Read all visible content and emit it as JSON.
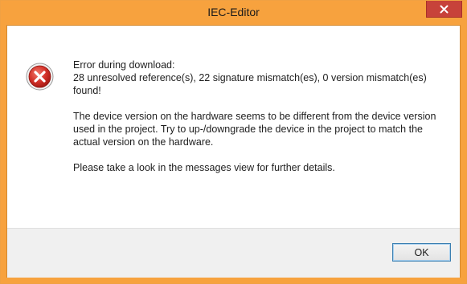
{
  "window": {
    "title": "IEC-Editor",
    "accent_color": "#f7a23e",
    "close_button_color": "#c7423a"
  },
  "dialog": {
    "icon": "error-icon",
    "message_lines": [
      "Error during download:",
      "28 unresolved reference(s), 22 signature mismatch(es), 0 version mismatch(es) found!"
    ],
    "detail": "The device version on the hardware seems to be different from the device version used in the project. Try to up-/downgrade the device in the project to match the actual version on the hardware.",
    "hint": "Please take a look in the messages view for further details."
  },
  "buttons": {
    "ok_label": "OK"
  }
}
